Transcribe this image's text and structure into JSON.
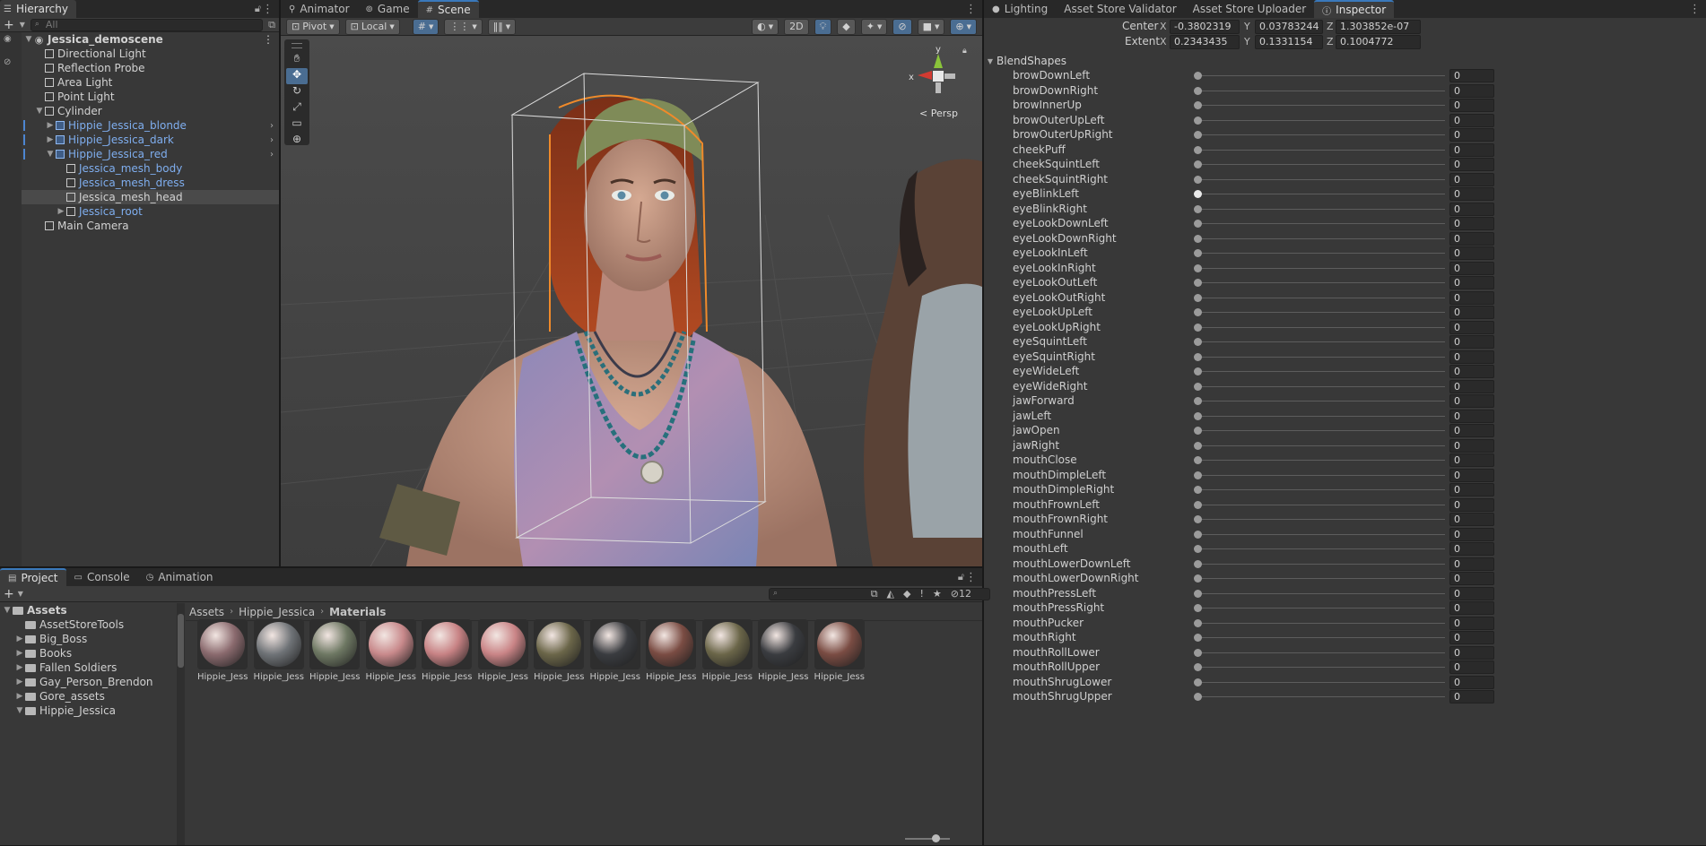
{
  "hierarchy": {
    "tab": "Hierarchy",
    "search_placeholder": "All",
    "items": [
      {
        "label": "Jessica_demoscene",
        "indent": 0,
        "type": "scene",
        "arrow": "▼",
        "color": "normal"
      },
      {
        "label": "Directional Light",
        "indent": 1,
        "type": "cube",
        "arrow": "",
        "color": "normal"
      },
      {
        "label": "Reflection Probe",
        "indent": 1,
        "type": "cube",
        "arrow": "",
        "color": "normal"
      },
      {
        "label": "Area Light",
        "indent": 1,
        "type": "cube",
        "arrow": "",
        "color": "normal"
      },
      {
        "label": "Point Light",
        "indent": 1,
        "type": "cube",
        "arrow": "",
        "color": "normal"
      },
      {
        "label": "Cylinder",
        "indent": 1,
        "type": "cube",
        "arrow": "▼",
        "color": "normal"
      },
      {
        "label": "Hippie_Jessica_blonde",
        "indent": 2,
        "type": "prefab",
        "arrow": "▶",
        "color": "blue"
      },
      {
        "label": "Hippie_Jessica_dark",
        "indent": 2,
        "type": "prefab",
        "arrow": "▶",
        "color": "blue"
      },
      {
        "label": "Hippie_Jessica_red",
        "indent": 2,
        "type": "prefab",
        "arrow": "▼",
        "color": "blue"
      },
      {
        "label": "Jessica_mesh_body",
        "indent": 3,
        "type": "cube",
        "arrow": "",
        "color": "blue"
      },
      {
        "label": "Jessica_mesh_dress",
        "indent": 3,
        "type": "cube",
        "arrow": "",
        "color": "blue"
      },
      {
        "label": "Jessica_mesh_head",
        "indent": 3,
        "type": "cube",
        "arrow": "",
        "color": "normal",
        "selected": true
      },
      {
        "label": "Jessica_root",
        "indent": 3,
        "type": "cube",
        "arrow": "▶",
        "color": "blue"
      },
      {
        "label": "Main Camera",
        "indent": 1,
        "type": "cube",
        "arrow": "",
        "color": "normal"
      }
    ]
  },
  "scene_tabs": [
    {
      "label": "Animator",
      "icon": "animator-icon",
      "active": false
    },
    {
      "label": "Game",
      "icon": "game-icon",
      "active": false
    },
    {
      "label": "Scene",
      "icon": "scene-icon",
      "active": true
    }
  ],
  "scene_toolbar": {
    "pivot": "Pivot",
    "local": "Local",
    "mode_2d": "2D"
  },
  "gizmo": {
    "y": "y",
    "x": "x",
    "persp": "Persp"
  },
  "inspector_tabs": [
    "Lighting",
    "Asset Store Validator",
    "Asset Store Uploader",
    "Inspector"
  ],
  "bounds": {
    "center_label": "Center",
    "extent_label": "Extent",
    "center": {
      "x": "-0.3802319",
      "y": "0.03783244",
      "z": "1.303852e-07"
    },
    "extent": {
      "x": "0.2343435",
      "y": "0.1331154",
      "z": "0.1004772"
    },
    "axis_x": "X",
    "axis_y": "Y",
    "axis_z": "Z"
  },
  "blendshapes": {
    "header": "BlendShapes",
    "items": [
      {
        "name": "browDownLeft",
        "value": "0"
      },
      {
        "name": "browDownRight",
        "value": "0"
      },
      {
        "name": "browInnerUp",
        "value": "0"
      },
      {
        "name": "browOuterUpLeft",
        "value": "0"
      },
      {
        "name": "browOuterUpRight",
        "value": "0"
      },
      {
        "name": "cheekPuff",
        "value": "0"
      },
      {
        "name": "cheekSquintLeft",
        "value": "0"
      },
      {
        "name": "cheekSquintRight",
        "value": "0"
      },
      {
        "name": "eyeBlinkLeft",
        "value": "0",
        "hover": true
      },
      {
        "name": "eyeBlinkRight",
        "value": "0"
      },
      {
        "name": "eyeLookDownLeft",
        "value": "0"
      },
      {
        "name": "eyeLookDownRight",
        "value": "0"
      },
      {
        "name": "eyeLookInLeft",
        "value": "0"
      },
      {
        "name": "eyeLookInRight",
        "value": "0"
      },
      {
        "name": "eyeLookOutLeft",
        "value": "0"
      },
      {
        "name": "eyeLookOutRight",
        "value": "0"
      },
      {
        "name": "eyeLookUpLeft",
        "value": "0"
      },
      {
        "name": "eyeLookUpRight",
        "value": "0"
      },
      {
        "name": "eyeSquintLeft",
        "value": "0"
      },
      {
        "name": "eyeSquintRight",
        "value": "0"
      },
      {
        "name": "eyeWideLeft",
        "value": "0"
      },
      {
        "name": "eyeWideRight",
        "value": "0"
      },
      {
        "name": "jawForward",
        "value": "0"
      },
      {
        "name": "jawLeft",
        "value": "0"
      },
      {
        "name": "jawOpen",
        "value": "0"
      },
      {
        "name": "jawRight",
        "value": "0"
      },
      {
        "name": "mouthClose",
        "value": "0"
      },
      {
        "name": "mouthDimpleLeft",
        "value": "0"
      },
      {
        "name": "mouthDimpleRight",
        "value": "0"
      },
      {
        "name": "mouthFrownLeft",
        "value": "0"
      },
      {
        "name": "mouthFrownRight",
        "value": "0"
      },
      {
        "name": "mouthFunnel",
        "value": "0"
      },
      {
        "name": "mouthLeft",
        "value": "0"
      },
      {
        "name": "mouthLowerDownLeft",
        "value": "0"
      },
      {
        "name": "mouthLowerDownRight",
        "value": "0"
      },
      {
        "name": "mouthPressLeft",
        "value": "0"
      },
      {
        "name": "mouthPressRight",
        "value": "0"
      },
      {
        "name": "mouthPucker",
        "value": "0"
      },
      {
        "name": "mouthRight",
        "value": "0"
      },
      {
        "name": "mouthRollLower",
        "value": "0"
      },
      {
        "name": "mouthRollUpper",
        "value": "0"
      },
      {
        "name": "mouthShrugLower",
        "value": "0"
      },
      {
        "name": "mouthShrugUpper",
        "value": "0"
      }
    ]
  },
  "bottom_tabs": [
    {
      "label": "Project",
      "active": true
    },
    {
      "label": "Console",
      "active": false
    },
    {
      "label": "Animation",
      "active": false
    }
  ],
  "project": {
    "hidden_count": "12",
    "tree": [
      {
        "label": "Assets",
        "indent": 0,
        "arrow": "▼",
        "bold": true
      },
      {
        "label": "AssetStoreTools",
        "indent": 1,
        "arrow": ""
      },
      {
        "label": "Big_Boss",
        "indent": 1,
        "arrow": "▶"
      },
      {
        "label": "Books",
        "indent": 1,
        "arrow": "▶"
      },
      {
        "label": "Fallen Soldiers",
        "indent": 1,
        "arrow": "▶"
      },
      {
        "label": "Gay_Person_Brendon",
        "indent": 1,
        "arrow": "▶"
      },
      {
        "label": "Gore_assets",
        "indent": 1,
        "arrow": "▶"
      },
      {
        "label": "Hippie_Jessica",
        "indent": 1,
        "arrow": "▼"
      }
    ],
    "breadcrumb": [
      "Assets",
      "Hippie_Jessica",
      "Materials"
    ],
    "materials": [
      {
        "label": "Hippie_Jess...",
        "color": "#8a6a6e"
      },
      {
        "label": "Hippie_Jess...",
        "color": "#6f7377"
      },
      {
        "label": "Hippie_Jess...",
        "color": "#6e7863"
      },
      {
        "label": "Hippie_Jess...",
        "color": "#c8898b"
      },
      {
        "label": "Hippie_Jess...",
        "color": "#c78284"
      },
      {
        "label": "Hippie_Jess...",
        "color": "#c98486"
      },
      {
        "label": "Hippie_Jess...",
        "color": "#6b6649"
      },
      {
        "label": "Hippie_Jess...",
        "color": "#3a3c40"
      },
      {
        "label": "Hippie_Jess...",
        "color": "#7a4c43"
      },
      {
        "label": "Hippie_Jess...",
        "color": "#6b6649"
      },
      {
        "label": "Hippie_Jess...",
        "color": "#3a3c40"
      },
      {
        "label": "Hippie_Jess...",
        "color": "#7a4c43"
      }
    ]
  }
}
